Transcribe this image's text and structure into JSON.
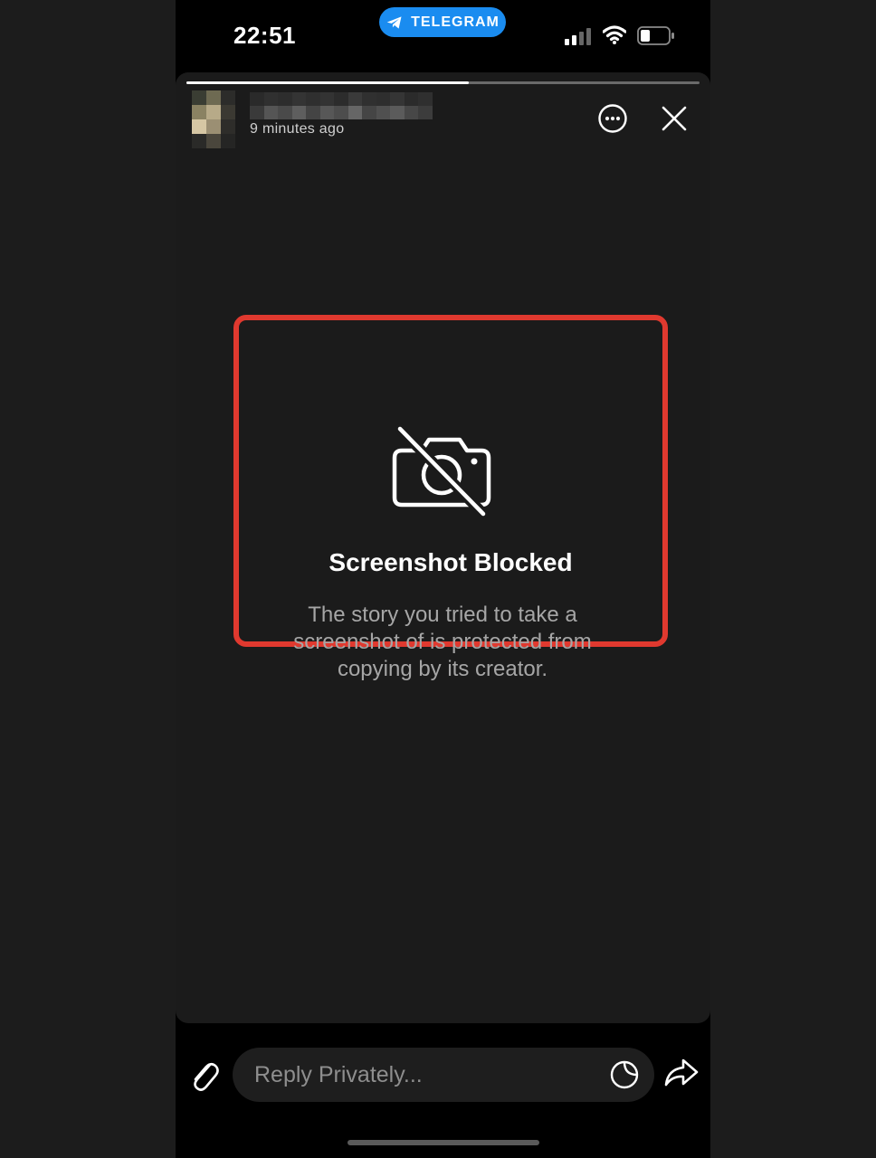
{
  "status_bar": {
    "time": "22:51",
    "app_pill": "TELEGRAM",
    "app_pill_color": "#1a8cf0"
  },
  "story": {
    "progress": 0.55,
    "time_ago": "9 minutes ago",
    "icons": {
      "more": "ellipsis-circle-icon",
      "close": "close-icon"
    }
  },
  "notice": {
    "icon": "camera-slash-icon",
    "title": "Screenshot Blocked",
    "body": "The story you tried to take a screenshot of is protected from copying by its creator.",
    "border_color": "#e0392f"
  },
  "reply_bar": {
    "placeholder": "Reply Privately...",
    "icons": {
      "attach": "paperclip-icon",
      "sticker": "sticker-icon",
      "share": "share-arrow-icon"
    }
  }
}
